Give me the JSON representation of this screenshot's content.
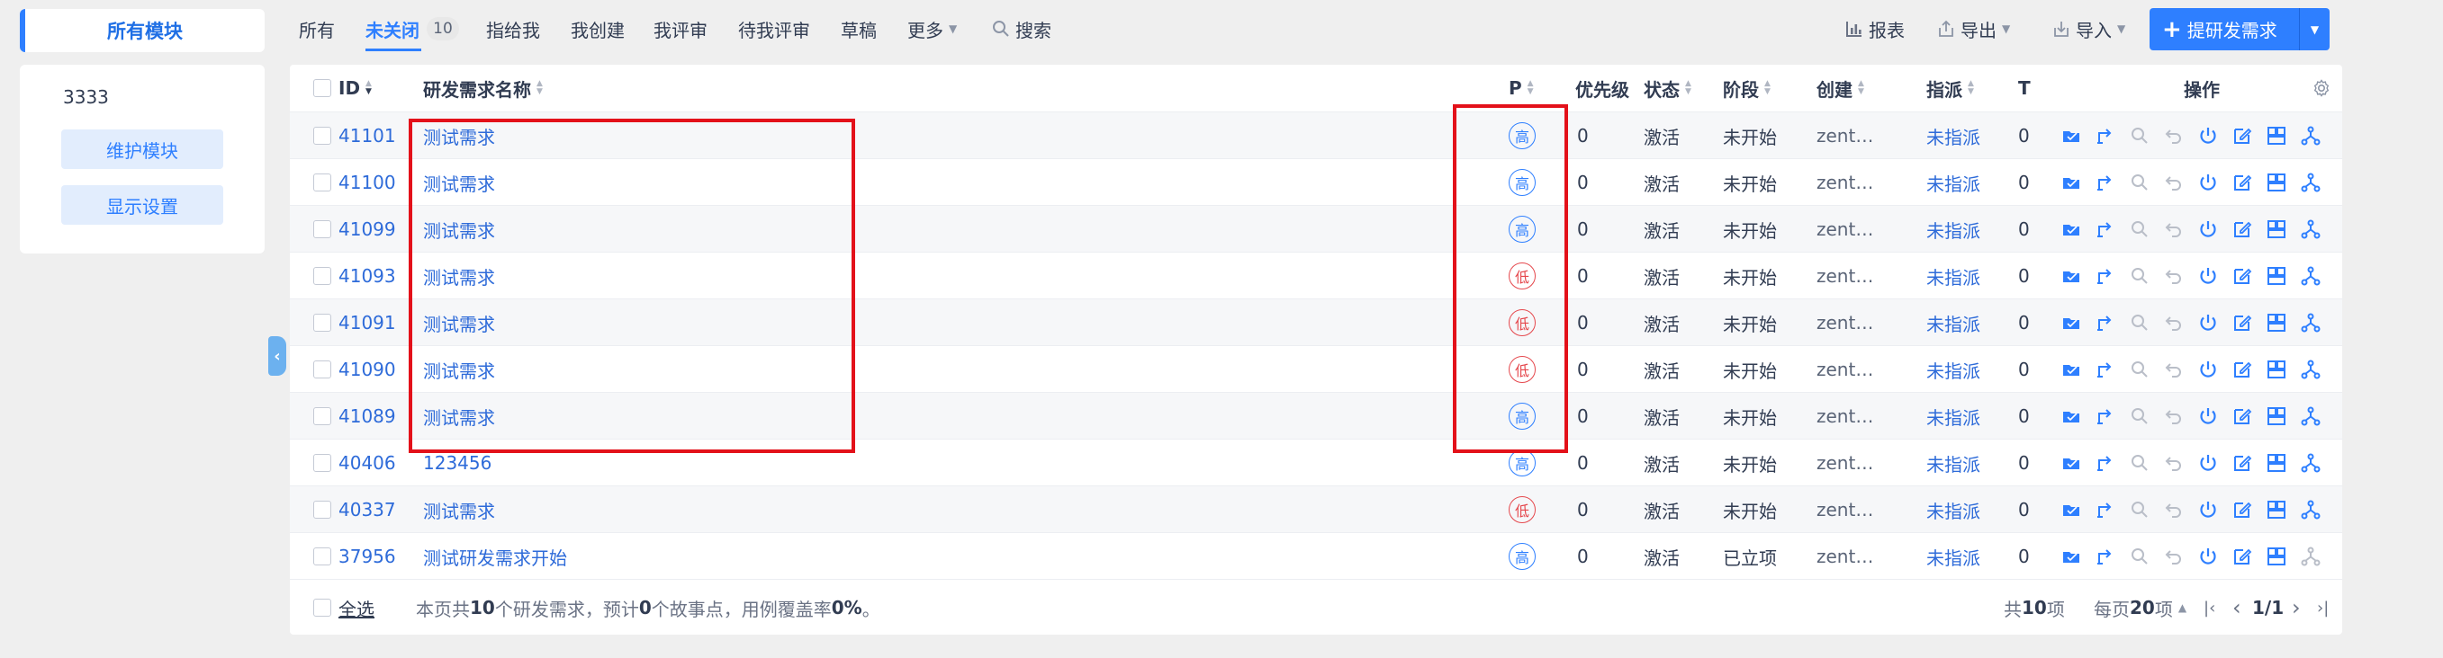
{
  "sidebar": {
    "all_modules": "所有模块",
    "module_item": "3333",
    "maintain_button": "维护模块",
    "display_settings_button": "显示设置"
  },
  "nav": {
    "tabs": [
      {
        "label": "所有"
      },
      {
        "label": "未关闭",
        "count": "10",
        "active": true
      },
      {
        "label": "指给我"
      },
      {
        "label": "我创建"
      },
      {
        "label": "我评审"
      },
      {
        "label": "待我评审"
      },
      {
        "label": "草稿"
      },
      {
        "label": "更多"
      }
    ],
    "search": "搜索",
    "report": "报表",
    "export": "导出",
    "import": "导入",
    "create": "提研发需求"
  },
  "table": {
    "headers": {
      "id": "ID",
      "name": "研发需求名称",
      "p": "P",
      "priority": "优先级",
      "status": "状态",
      "stage": "阶段",
      "creator": "创建",
      "assignee": "指派",
      "t": "T",
      "actions": "操作"
    },
    "rows": [
      {
        "id": "41101",
        "name": "测试需求",
        "p": "高",
        "level": "high",
        "priority": "0",
        "status": "激活",
        "stage": "未开始",
        "creator": "zent…",
        "assignee": "未指派",
        "t": "0"
      },
      {
        "id": "41100",
        "name": "测试需求",
        "p": "高",
        "level": "high",
        "priority": "0",
        "status": "激活",
        "stage": "未开始",
        "creator": "zent…",
        "assignee": "未指派",
        "t": "0"
      },
      {
        "id": "41099",
        "name": "测试需求",
        "p": "高",
        "level": "high",
        "priority": "0",
        "status": "激活",
        "stage": "未开始",
        "creator": "zent…",
        "assignee": "未指派",
        "t": "0"
      },
      {
        "id": "41093",
        "name": "测试需求",
        "p": "低",
        "level": "low",
        "priority": "0",
        "status": "激活",
        "stage": "未开始",
        "creator": "zent…",
        "assignee": "未指派",
        "t": "0"
      },
      {
        "id": "41091",
        "name": "测试需求",
        "p": "低",
        "level": "low",
        "priority": "0",
        "status": "激活",
        "stage": "未开始",
        "creator": "zent…",
        "assignee": "未指派",
        "t": "0"
      },
      {
        "id": "41090",
        "name": "测试需求",
        "p": "低",
        "level": "low",
        "priority": "0",
        "status": "激活",
        "stage": "未开始",
        "creator": "zent…",
        "assignee": "未指派",
        "t": "0"
      },
      {
        "id": "41089",
        "name": "测试需求",
        "p": "高",
        "level": "high",
        "priority": "0",
        "status": "激活",
        "stage": "未开始",
        "creator": "zent…",
        "assignee": "未指派",
        "t": "0"
      },
      {
        "id": "40406",
        "name": "123456",
        "p": "高",
        "level": "high",
        "priority": "0",
        "status": "激活",
        "stage": "未开始",
        "creator": "zent…",
        "assignee": "未指派",
        "t": "0"
      },
      {
        "id": "40337",
        "name": "测试需求",
        "p": "低",
        "level": "low",
        "priority": "0",
        "status": "激活",
        "stage": "未开始",
        "creator": "zent…",
        "assignee": "未指派",
        "t": "0"
      },
      {
        "id": "37956",
        "name": "测试研发需求开始",
        "p": "高",
        "level": "high",
        "priority": "0",
        "status": "激活",
        "stage": "已立项",
        "creator": "zent…",
        "assignee": "未指派",
        "t": "0"
      }
    ]
  },
  "footer": {
    "select_all": "全选",
    "summary_prefix": "本页共 ",
    "summary_count": "10",
    "summary_mid1": " 个研发需求，预计 ",
    "summary_points": "0",
    "summary_mid2": " 个故事点，用例覆盖率 ",
    "summary_coverage": "0%",
    "summary_suffix": "。",
    "total_prefix": "共 ",
    "total_count": "10",
    "total_suffix": " 项",
    "per_page_prefix": "每页 ",
    "per_page": "20",
    "per_page_suffix": " 项",
    "page": "1/1"
  },
  "colors": {
    "accent": "#2e7fff",
    "high": "#2e7fff",
    "low": "#e5484d",
    "highlight_box": "#e3111a"
  }
}
